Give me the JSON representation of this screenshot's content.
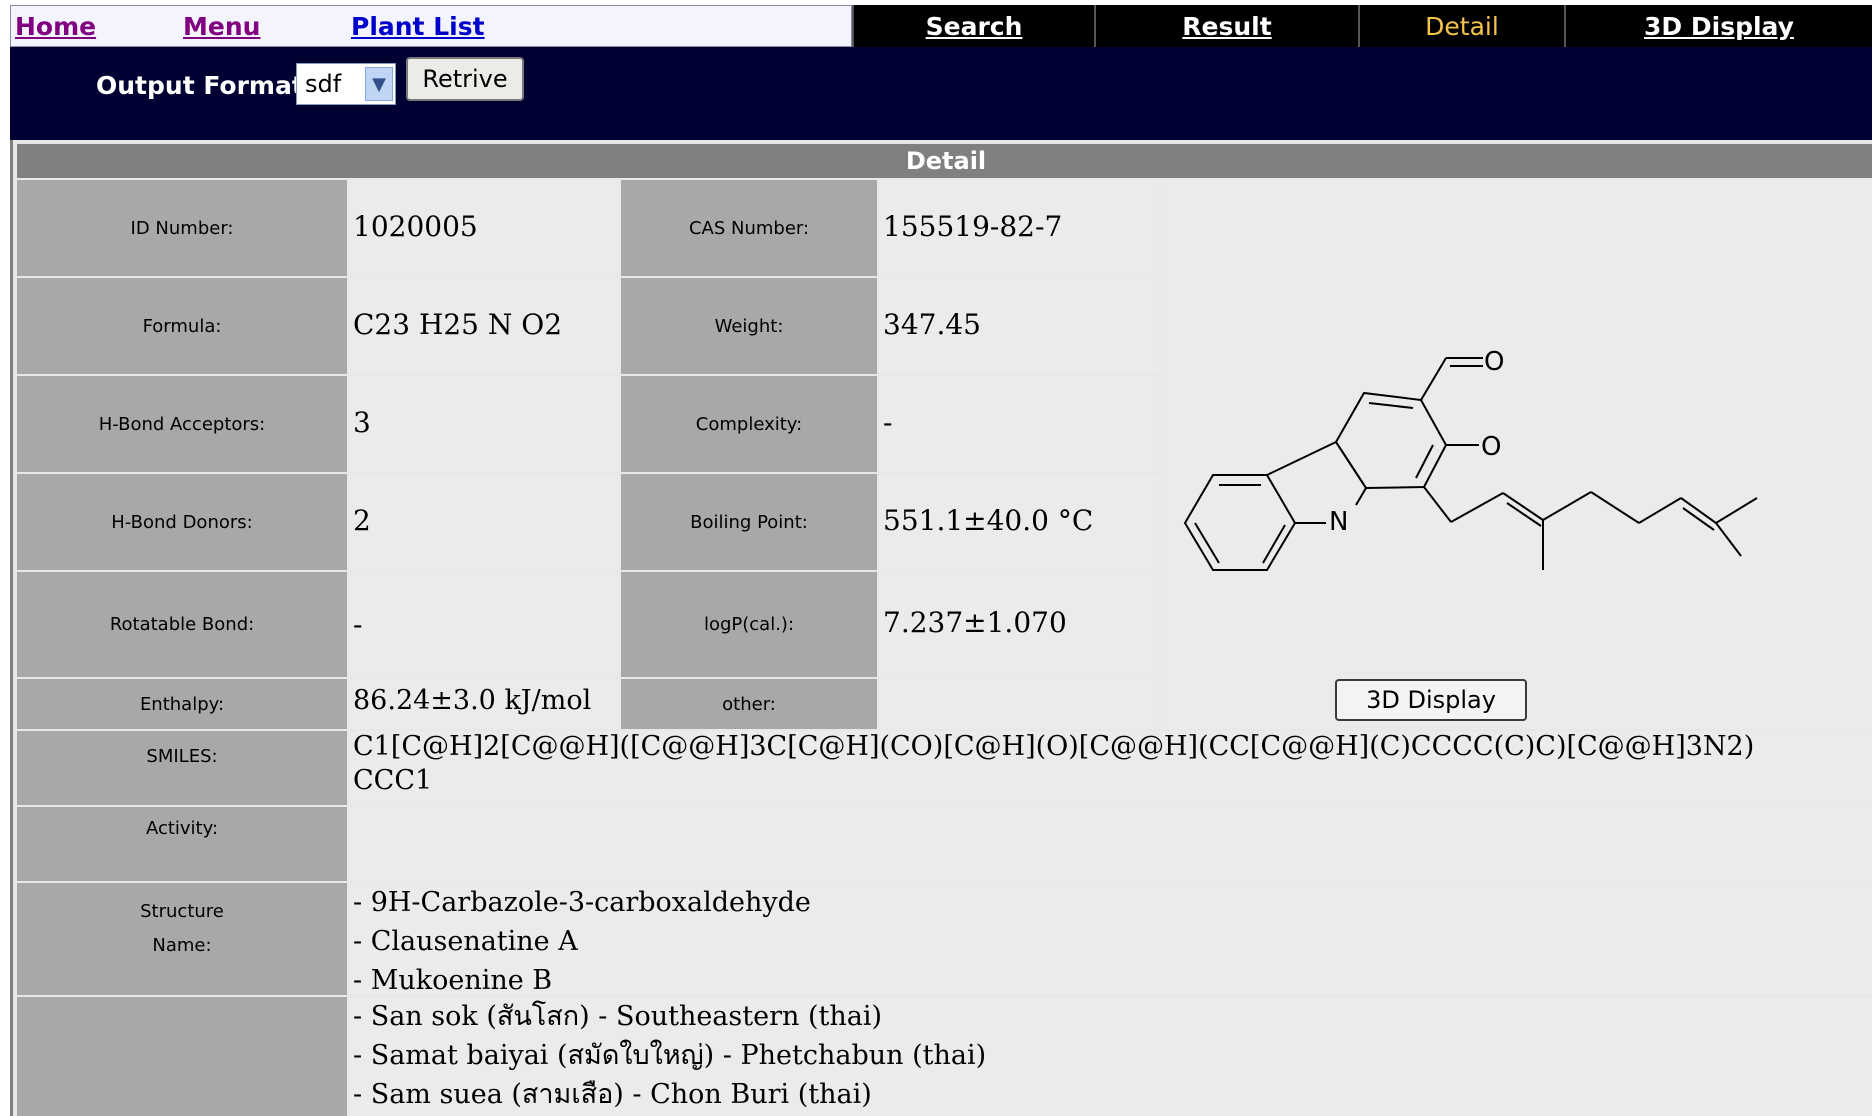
{
  "nav": {
    "home": "Home",
    "menu": "Menu",
    "plant_list": "Plant List",
    "search": "Search",
    "result": "Result",
    "detail": "Detail",
    "display3d": "3D Display"
  },
  "output": {
    "label": "Output Format",
    "format": "sdf",
    "retrive": "Retrive"
  },
  "detail": {
    "header": "Detail",
    "labels": {
      "id": "ID Number:",
      "cas": "CAS Number:",
      "formula": "Formula:",
      "weight": "Weight:",
      "hba": "H-Bond Acceptors:",
      "complexity": "Complexity:",
      "hbd": "H-Bond Donors:",
      "boiling": "Boiling Point:",
      "rotatable": "Rotatable Bond:",
      "logp": "logP(cal.):",
      "enthalpy": "Enthalpy:",
      "other": "other:",
      "smiles": "SMILES:",
      "activity": "Activity:",
      "structure_name_1": "Structure",
      "structure_name_2": "Name:"
    },
    "values": {
      "id": "1020005",
      "cas": "155519-82-7",
      "formula": "C23 H25 N O2",
      "weight": "347.45",
      "hba": "3",
      "complexity": "-",
      "hbd": "2",
      "boiling": "551.1±40.0 °C",
      "rotatable": "-",
      "logp": "7.237±1.070",
      "enthalpy": "86.24±3.0 kJ/mol",
      "other": "",
      "smiles_line1": "C1[C@H]2[C@@H]([C@@H]3C[C@H](CO)[C@H](O)[C@@H](CC[C@@H](C)CCCC(C)C)[C@@H]3N2)",
      "smiles_line2": "CCC1",
      "activity": ""
    },
    "structure_names": [
      "- 9H-Carbazole-3-carboxaldehyde",
      "- Clausenatine A",
      "- Mukoenine B"
    ],
    "local_names": [
      "- San sok (สันโสก) - Southeastern (thai)",
      "- Samat baiyai (สมัดใบใหญ่) - Phetchabun (thai)",
      "- Sam suea (สามเสือ) - Chon Buri (thai)"
    ],
    "structure_atoms": [
      "O",
      "O",
      "N"
    ],
    "button_3d": "3D Display"
  }
}
